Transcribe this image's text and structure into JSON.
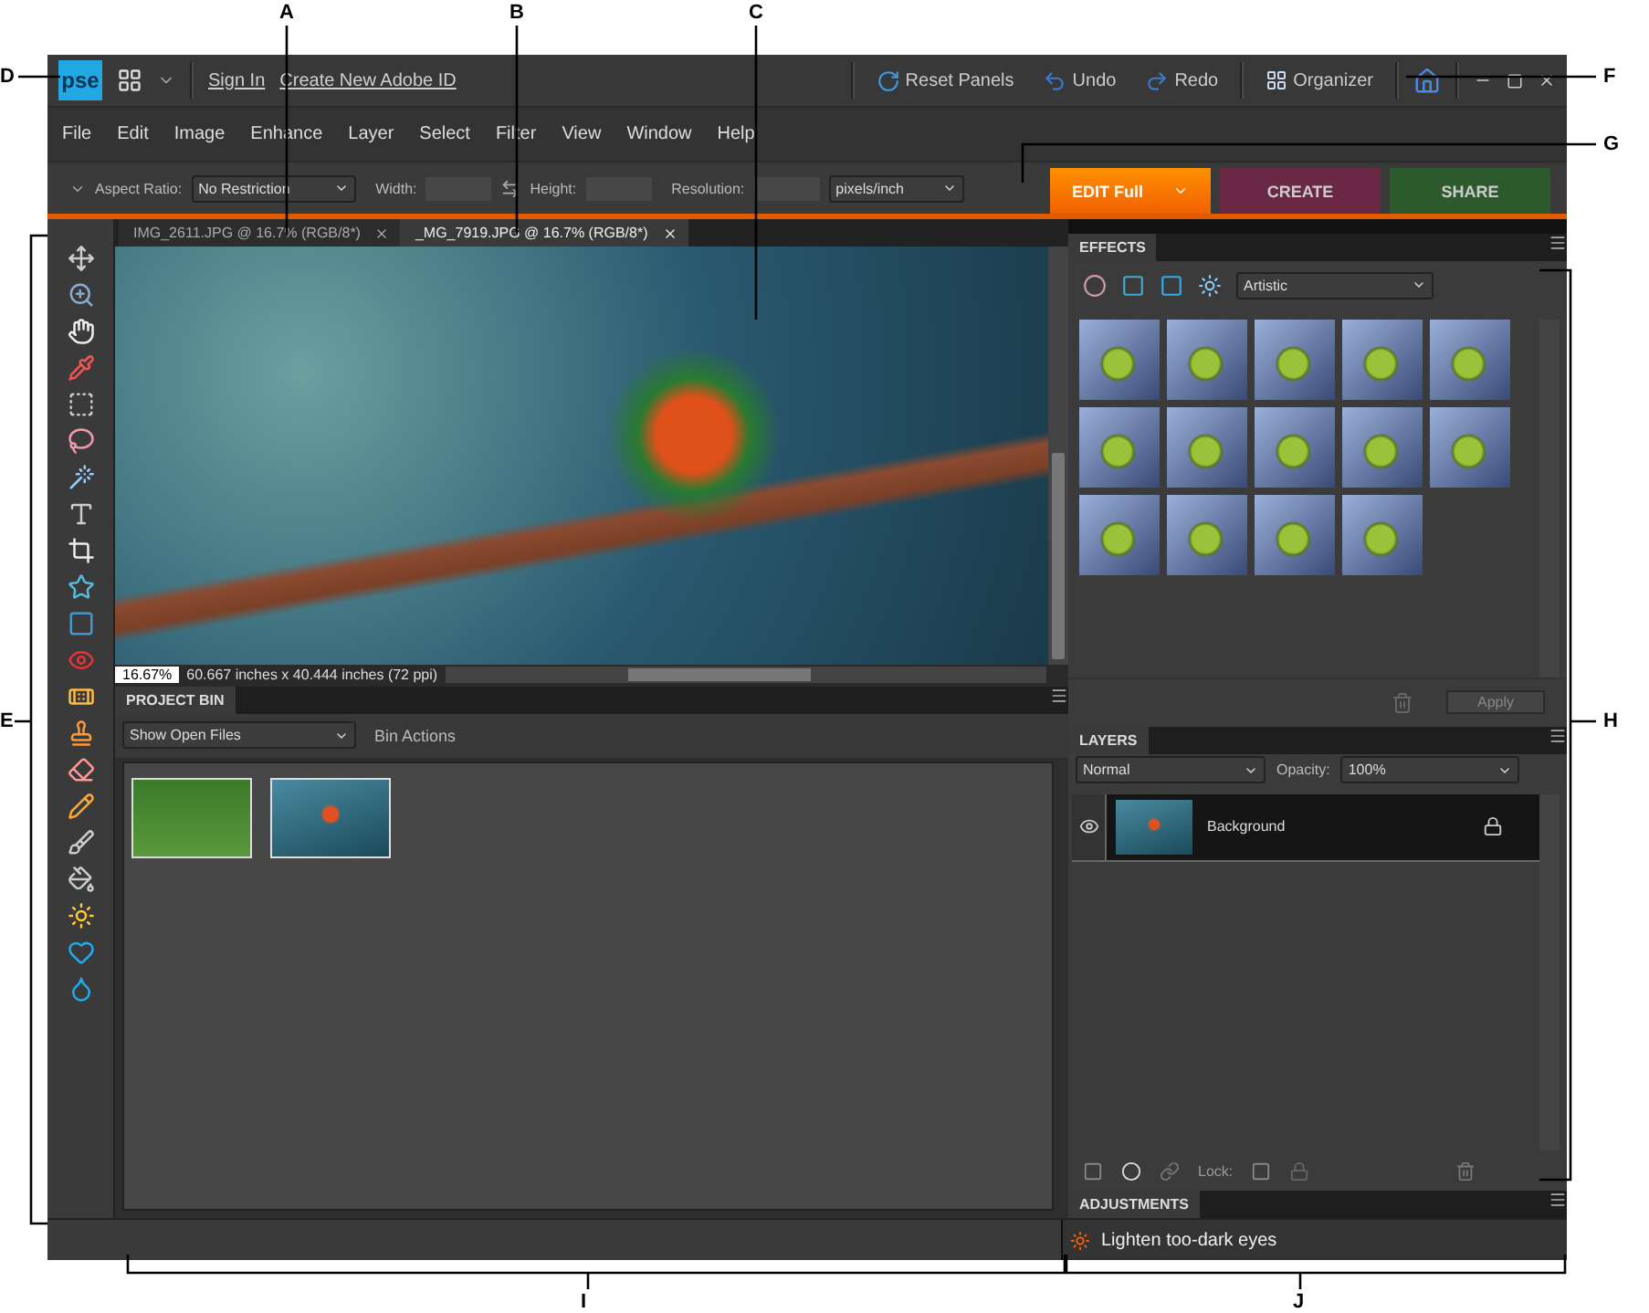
{
  "top_bar": {
    "logo": "pse",
    "links": [
      "Sign In",
      "Create New Adobe ID"
    ],
    "actions": [
      {
        "kind": "reset",
        "label": "Reset Panels"
      },
      {
        "kind": "undo",
        "label": "Undo"
      },
      {
        "kind": "redo",
        "label": "Redo"
      },
      {
        "kind": "organizer",
        "label": "Organizer"
      }
    ]
  },
  "menu": [
    "File",
    "Edit",
    "Image",
    "Enhance",
    "Layer",
    "Select",
    "Filter",
    "View",
    "Window",
    "Help"
  ],
  "options_bar": {
    "aspect_label": "Aspect Ratio:",
    "aspect_value": "No Restriction",
    "width_label": "Width:",
    "height_label": "Height:",
    "resolution_label": "Resolution:",
    "unit_value": "pixels/inch"
  },
  "mode_tabs": [
    {
      "label": "EDIT Full",
      "selected": true
    },
    {
      "label": "CREATE",
      "selected": false
    },
    {
      "label": "SHARE",
      "selected": false
    }
  ],
  "doc_tabs": [
    {
      "label": "IMG_2611.JPG @ 16.7% (RGB/8*)",
      "selected": false
    },
    {
      "label": "_MG_7919.JPG @ 16.7% (RGB/8*)",
      "selected": true
    }
  ],
  "status": {
    "zoom": "16.67%",
    "size": "60.667 inches x 40.444 inches (72 ppi)"
  },
  "project_bin": {
    "title": "PROJECT BIN",
    "filter": "Show Open Files",
    "actions": "Bin Actions"
  },
  "effects": {
    "title": "EFFECTS",
    "category": "Artistic",
    "apply": "Apply"
  },
  "layers": {
    "title": "LAYERS",
    "blend_mode": "Normal",
    "opacity_label": "Opacity:",
    "opacity_value": "100%",
    "lock_label": "Lock:",
    "items": [
      {
        "name": "Background",
        "visible": true,
        "locked": true
      }
    ]
  },
  "adjustments": {
    "title": "ADJUSTMENTS"
  },
  "hint": "Lighten too-dark eyes",
  "callouts": [
    "A",
    "B",
    "C",
    "D",
    "E",
    "F",
    "G",
    "H",
    "I",
    "J"
  ]
}
